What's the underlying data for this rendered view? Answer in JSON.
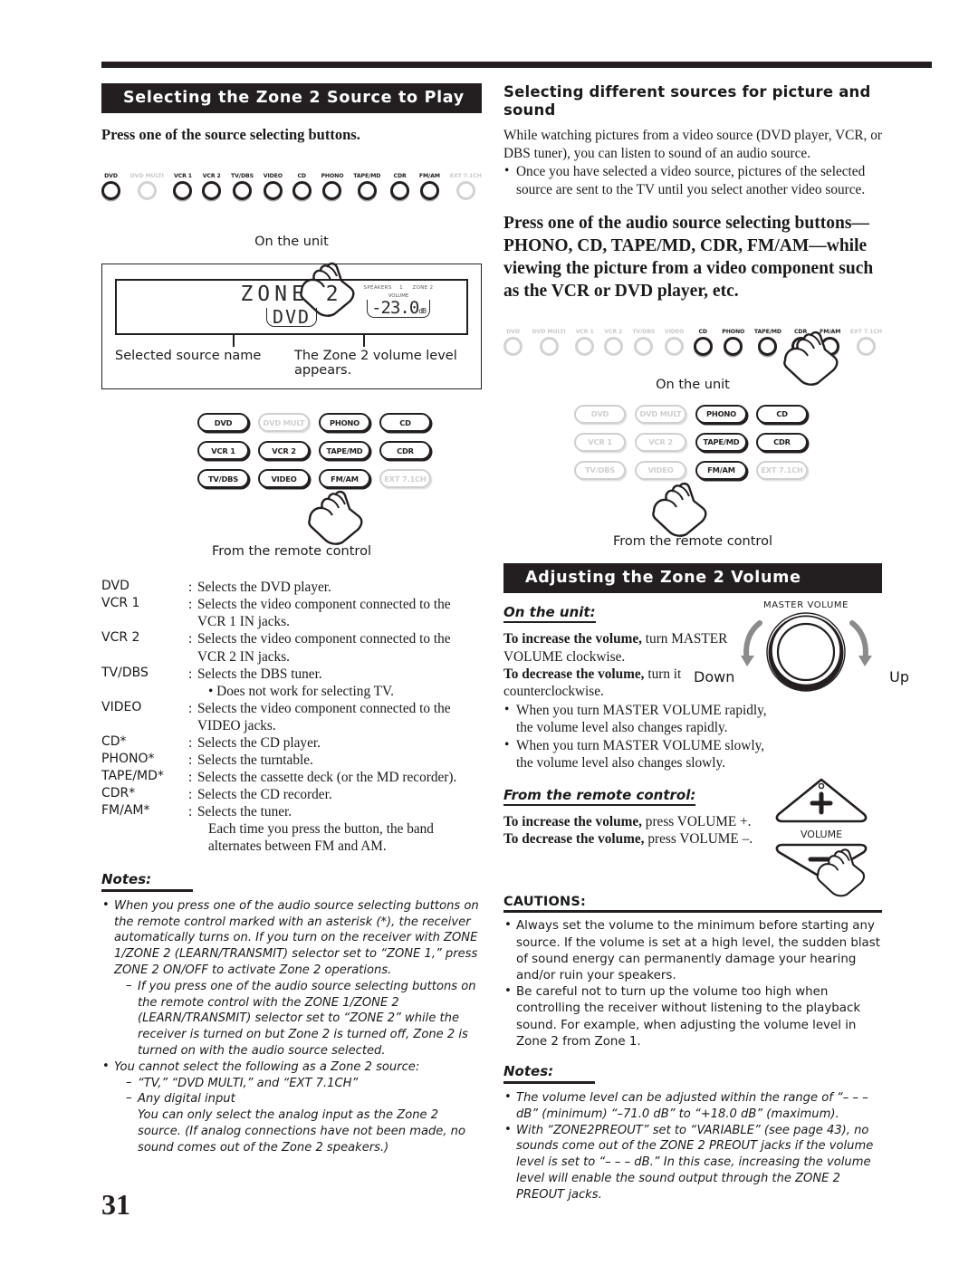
{
  "page_number": "31",
  "left": {
    "section_title": "Selecting the Zone 2 Source to Play",
    "instruction": "Press one of the source selecting buttons.",
    "unit_caption": "On the unit",
    "remote_caption": "From the remote control",
    "unit_buttons": [
      {
        "label": "DVD",
        "active": true
      },
      {
        "label": "DVD MULTI",
        "active": false
      },
      {
        "label": "VCR 1",
        "active": true
      },
      {
        "label": "VCR 2",
        "active": true
      },
      {
        "label": "TV/DBS",
        "active": true
      },
      {
        "label": "VIDEO",
        "active": true
      },
      {
        "label": "CD",
        "active": true
      },
      {
        "label": "PHONO",
        "active": true
      },
      {
        "label": "TAPE/MD",
        "active": true
      },
      {
        "label": "CDR",
        "active": true
      },
      {
        "label": "FM/AM",
        "active": true
      },
      {
        "label": "EXT 7.1CH",
        "active": false
      }
    ],
    "remote_buttons": [
      {
        "label": "DVD",
        "active": true
      },
      {
        "label": "DVD MULTI",
        "active": false
      },
      {
        "label": "PHONO",
        "active": true
      },
      {
        "label": "CD",
        "active": true
      },
      {
        "label": "VCR 1",
        "active": true
      },
      {
        "label": "VCR 2",
        "active": true
      },
      {
        "label": "TAPE/MD",
        "active": true
      },
      {
        "label": "CDR",
        "active": true
      },
      {
        "label": "TV/DBS",
        "active": true
      },
      {
        "label": "VIDEO",
        "active": true
      },
      {
        "label": "FM/AM",
        "active": true
      },
      {
        "label": "EXT 7.1CH",
        "active": false
      }
    ],
    "display": {
      "zone_text": "ZONE 2",
      "source_text": "DVD",
      "indicator_speakers": "SPEAKERS",
      "indicator_one": "1",
      "indicator_zone2": "ZONE 2",
      "volume_label": "VOLUME",
      "volume_value": "-23.0",
      "volume_unit": "dB",
      "caption_source": "Selected source name",
      "caption_volume": "The Zone 2 volume level appears."
    },
    "source_list": [
      {
        "name": "DVD",
        "desc": "Selects the DVD player.",
        "sub": []
      },
      {
        "name": "VCR 1",
        "desc": "Selects the video component connected to the VCR 1 IN jacks.",
        "sub": []
      },
      {
        "name": "VCR 2",
        "desc": "Selects the video component connected to the VCR 2 IN jacks.",
        "sub": []
      },
      {
        "name": "TV/DBS",
        "desc": "Selects the DBS tuner.",
        "sub": [
          "• Does not work for selecting TV."
        ]
      },
      {
        "name": "VIDEO",
        "desc": "Selects the video component connected to the VIDEO jacks.",
        "sub": []
      },
      {
        "name": "CD*",
        "desc": "Selects the CD player.",
        "sub": []
      },
      {
        "name": "PHONO*",
        "desc": "Selects the turntable.",
        "sub": []
      },
      {
        "name": "TAPE/MD*",
        "desc": "Selects the cassette deck (or the MD recorder).",
        "sub": []
      },
      {
        "name": "CDR*",
        "desc": "Selects the CD recorder.",
        "sub": []
      },
      {
        "name": "FM/AM*",
        "desc": "Selects the tuner.",
        "sub": [
          "Each time you press the button, the band alternates between FM and AM."
        ]
      }
    ],
    "notes_heading": "Notes:",
    "notes": [
      {
        "text": "When you press one of the audio source selecting buttons on the remote control marked with an asterisk (*), the receiver automatically turns on. If you turn on the receiver with ZONE 1/ZONE 2 (LEARN/TRANSMIT) selector set to “ZONE 1,” press ZONE 2 ON/OFF to activate Zone 2 operations.",
        "sub": [
          {
            "text": "If you press one of the audio source selecting buttons on the remote control with the ZONE 1/ZONE 2 (LEARN/TRANSMIT) selector set to “ZONE 2” while the receiver is turned on but Zone 2 is turned off, Zone 2 is turned on with the audio source selected.",
            "extra": []
          }
        ]
      },
      {
        "text": "You cannot select the following as a Zone 2 source:",
        "sub": [
          {
            "text": "“TV,” “DVD MULTI,” and “EXT 7.1CH”",
            "extra": []
          },
          {
            "text": "Any digital input",
            "extra": [
              "You can only select the analog input as the Zone 2 source. (If analog connections have not been made, no sound comes out of the Zone 2 speakers.)"
            ]
          }
        ]
      }
    ]
  },
  "right": {
    "heading1": "Selecting different sources for picture and sound",
    "para1": "While watching pictures from a video source (DVD player, VCR, or DBS tuner), you can listen to sound of an audio source.",
    "bullet1": "Once you have selected a video source, pictures of the selected source are sent to the TV until you select another video source.",
    "bold_instruction": "Press one of the audio source selecting buttons—PHONO, CD, TAPE/MD, CDR, FM/AM—while viewing the picture from a video component such as the VCR or DVD player, etc.",
    "unit_caption": "On the unit",
    "remote_caption": "From the remote control",
    "unit_buttons": [
      {
        "label": "DVD",
        "active": false
      },
      {
        "label": "DVD MULTI",
        "active": false
      },
      {
        "label": "VCR 1",
        "active": false
      },
      {
        "label": "VCR 2",
        "active": false
      },
      {
        "label": "TV/DBS",
        "active": false
      },
      {
        "label": "VIDEO",
        "active": false
      },
      {
        "label": "CD",
        "active": true
      },
      {
        "label": "PHONO",
        "active": true
      },
      {
        "label": "TAPE/MD",
        "active": true
      },
      {
        "label": "CDR",
        "active": true
      },
      {
        "label": "FM/AM",
        "active": true
      },
      {
        "label": "EXT 7.1CH",
        "active": false
      }
    ],
    "remote_buttons": [
      {
        "label": "DVD",
        "active": false
      },
      {
        "label": "DVD MULTI",
        "active": false
      },
      {
        "label": "PHONO",
        "active": true
      },
      {
        "label": "CD",
        "active": true
      },
      {
        "label": "VCR 1",
        "active": false
      },
      {
        "label": "VCR 2",
        "active": false
      },
      {
        "label": "TAPE/MD",
        "active": true
      },
      {
        "label": "CDR",
        "active": true
      },
      {
        "label": "TV/DBS",
        "active": false
      },
      {
        "label": "VIDEO",
        "active": false
      },
      {
        "label": "FM/AM",
        "active": true
      },
      {
        "label": "EXT 7.1CH",
        "active": false
      }
    ],
    "volume_section_title": "Adjusting the Zone 2 Volume",
    "on_unit_heading": "On the unit:",
    "on_unit_line1_bold": "To increase the volume,",
    "on_unit_line1_rest": " turn MASTER VOLUME clockwise.",
    "on_unit_line2_bold": "To decrease the volume,",
    "on_unit_line2_rest": " turn it counterclockwise.",
    "on_unit_bullets": [
      "When you turn MASTER VOLUME rapidly, the volume level also changes rapidly.",
      "When you turn MASTER VOLUME slowly, the volume level also changes slowly."
    ],
    "knob_label": "MASTER  VOLUME",
    "knob_down": "Down",
    "knob_up": "Up",
    "from_remote_heading": "From the remote control:",
    "remote_line1_bold": "To increase the volume,",
    "remote_line1_rest": " press VOLUME +.",
    "remote_line2_bold": "To decrease the volume,",
    "remote_line2_rest": " press VOLUME –.",
    "volume_button_plus": "+",
    "volume_button_minus": "–",
    "volume_button_label": "VOLUME",
    "cautions_heading": "CAUTIONS:",
    "cautions": [
      "Always set the volume to the minimum before starting any source. If the volume is set at a high level, the sudden blast of sound energy can permanently damage your hearing and/or ruin your speakers.",
      "Be careful not to turn up the volume too high when controlling the receiver without listening to the playback sound. For example, when adjusting the volume level in Zone 2 from Zone 1."
    ],
    "notes_heading": "Notes:",
    "notes": [
      "The volume level can be adjusted within the range of “– – – dB” (minimum) “–71.0 dB” to “+18.0 dB” (maximum).",
      "With “ZONE2PREOUT” set to “VARIABLE” (see page 43), no sounds come out of the ZONE 2 PREOUT jacks if the volume level is set to “– – – dB.” In this case, increasing the volume level will enable the sound output through the ZONE 2 PREOUT jacks."
    ]
  },
  "colors": {
    "ink": "#231f20",
    "dim": "#cfcfcf",
    "paper": "#ffffff"
  }
}
